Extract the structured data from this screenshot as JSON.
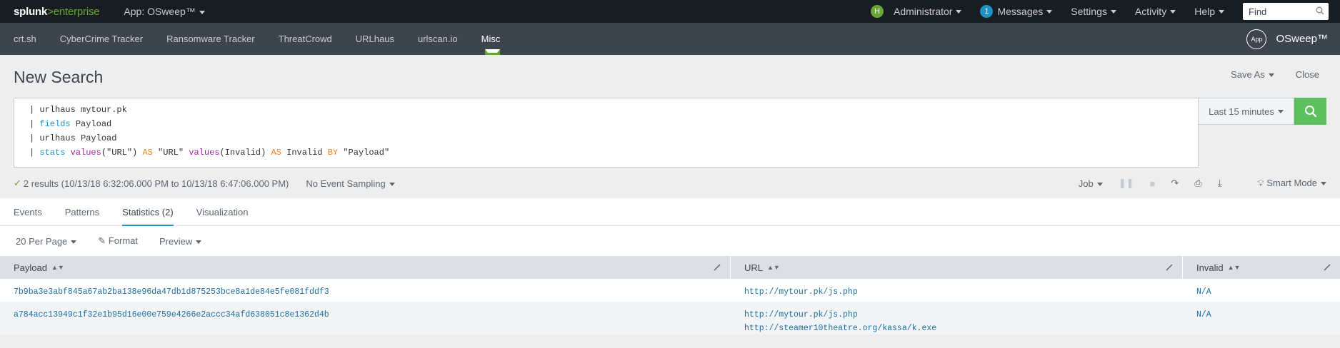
{
  "topbar": {
    "logo_main": "splunk",
    "logo_sep": ">",
    "logo_sub": "enterprise",
    "app_label": "App: OSweep™",
    "user_initial": "H",
    "user_label": "Administrator",
    "messages_count": "1",
    "messages_label": "Messages",
    "settings_label": "Settings",
    "activity_label": "Activity",
    "help_label": "Help",
    "find_placeholder": "Find"
  },
  "appbar": {
    "items": [
      "crt.sh",
      "CyberCrime Tracker",
      "Ransomware Tracker",
      "ThreatCrowd",
      "URLhaus",
      "urlscan.io",
      "Misc"
    ],
    "active_index": 6,
    "brand_circle": "App",
    "brand_name": "OSweep™"
  },
  "page": {
    "title": "New Search",
    "save_as": "Save As",
    "close": "Close"
  },
  "search": {
    "line1": "| urlhaus mytour.pk",
    "line2_pipe": "| ",
    "line2_cmd": "fields",
    "line2_rest": " Payload",
    "line3": "| urlhaus Payload",
    "line4_pipe": "| ",
    "line4_cmd": "stats",
    "line4_fn1": "values",
    "line4_arg1": "(\"URL\") ",
    "line4_as1": "AS",
    "line4_mid": " \"URL\" ",
    "line4_fn2": "values",
    "line4_arg2": "(Invalid) ",
    "line4_as2": "AS",
    "line4_mid2": " Invalid ",
    "line4_by": "BY",
    "line4_end": " \"Payload\"",
    "time_range": "Last 15 minutes"
  },
  "status": {
    "check": "✓",
    "results": "2 results (10/13/18 6:32:06.000 PM to 10/13/18 6:47:06.000 PM)",
    "sampling": "No Event Sampling",
    "job": "Job",
    "mode": "Smart Mode"
  },
  "tabs": [
    {
      "label": "Events"
    },
    {
      "label": "Patterns"
    },
    {
      "label": "Statistics (2)"
    },
    {
      "label": "Visualization"
    }
  ],
  "options": {
    "per_page": "20 Per Page",
    "format": "Format",
    "preview": "Preview"
  },
  "table": {
    "headers": [
      "Payload",
      "URL",
      "Invalid"
    ],
    "rows": [
      {
        "payload": "7b9ba3e3abf845a67ab2ba138e96da47db1d875253bce8a1de84e5fe081fddf3",
        "urls": [
          "http://mytour.pk/js.php"
        ],
        "invalid": "N/A"
      },
      {
        "payload": "a784acc13949c1f32e1b95d16e00e759e4266e2accc34afd638051c8e1362d4b",
        "urls": [
          "http://mytour.pk/js.php",
          "http://steamer10theatre.org/kassa/k.exe"
        ],
        "invalid": "N/A"
      }
    ]
  },
  "colors": {
    "topbar_bg": "#171d21",
    "appbar_bg": "#3c444d",
    "accent_green": "#65a637",
    "search_button": "#5cc05c",
    "link_blue": "#1a6fa3"
  }
}
